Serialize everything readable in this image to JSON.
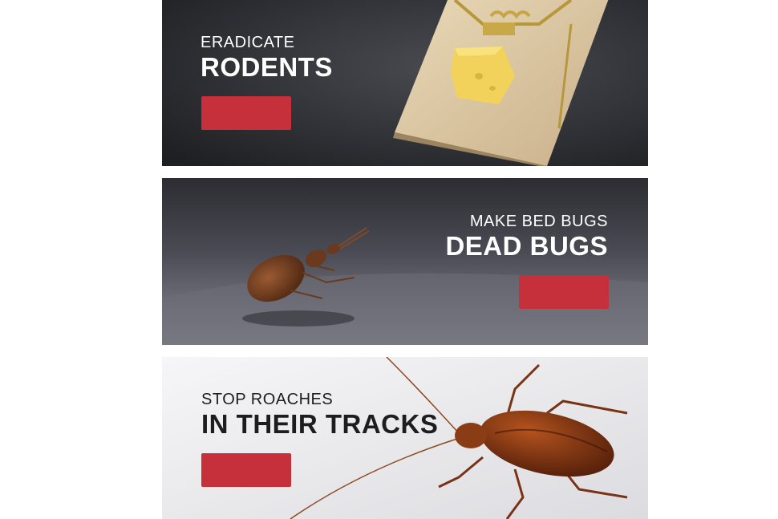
{
  "banners": [
    {
      "id": "rodents",
      "line1": "ERADICATE",
      "line2": "RODENTS",
      "cta_color": "#c6303b",
      "image": "mouse-trap-with-cheese"
    },
    {
      "id": "bed-bugs",
      "line1": "MAKE BED BUGS",
      "line2": "DEAD BUGS",
      "cta_color": "#c6303b",
      "image": "bed-bug-on-fabric"
    },
    {
      "id": "roaches",
      "line1": "STOP ROACHES",
      "line2": "IN THEIR TRACKS",
      "cta_color": "#c6303b",
      "image": "cockroach"
    }
  ]
}
